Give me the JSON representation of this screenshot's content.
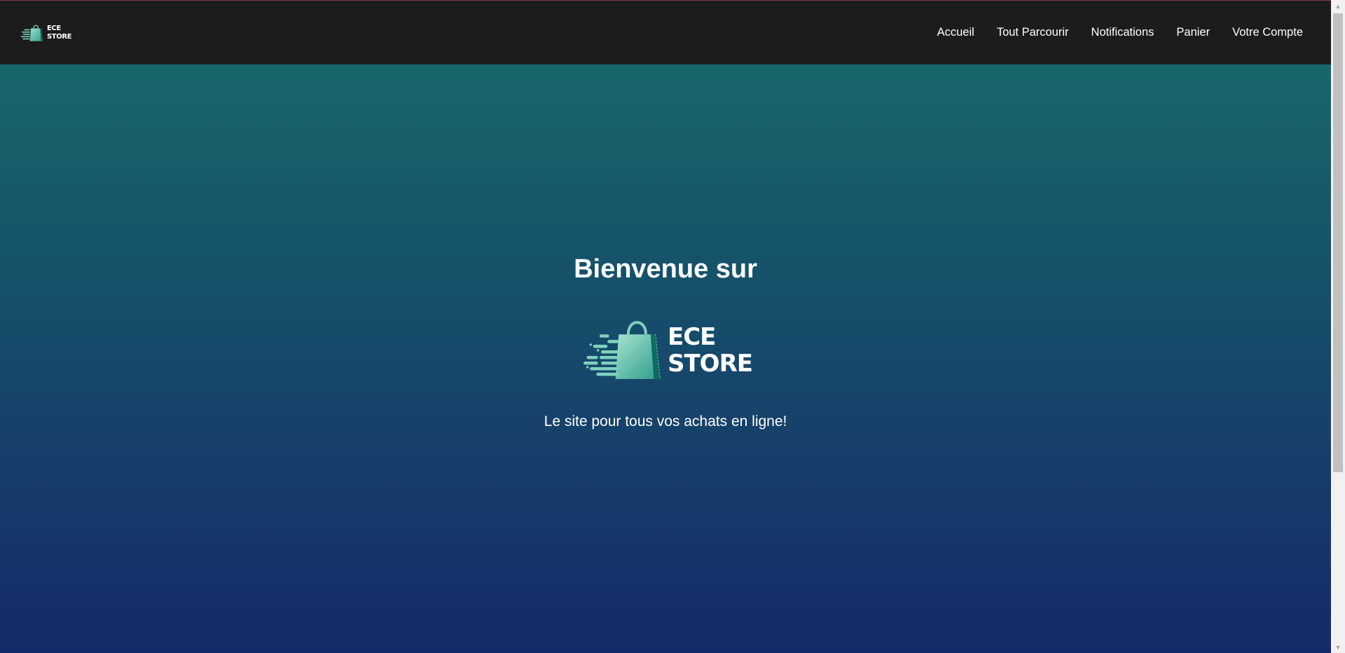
{
  "brand": {
    "logo_line1": "ECE",
    "logo_line2": "STORE"
  },
  "nav": {
    "links": [
      {
        "label": "Accueil"
      },
      {
        "label": "Tout Parcourir"
      },
      {
        "label": "Notifications"
      },
      {
        "label": "Panier"
      },
      {
        "label": "Votre Compte"
      }
    ]
  },
  "hero": {
    "title": "Bienvenue sur",
    "tagline": "Le site pour tous vos achats en ligne!"
  },
  "icons": {
    "logo": "shopping-bag-speed-icon",
    "scroll_up": "triangle-up-icon",
    "scroll_down": "triangle-down-icon"
  },
  "colors": {
    "navbar_bg": "#1c1c1c",
    "top_accent": "#8a3a5a",
    "hero_gradient_top": "#17676a",
    "hero_gradient_bottom": "#152a6a",
    "bag_light": "#7fd1bd",
    "bag_dark": "#2e9c8a",
    "text": "#ffffff"
  }
}
